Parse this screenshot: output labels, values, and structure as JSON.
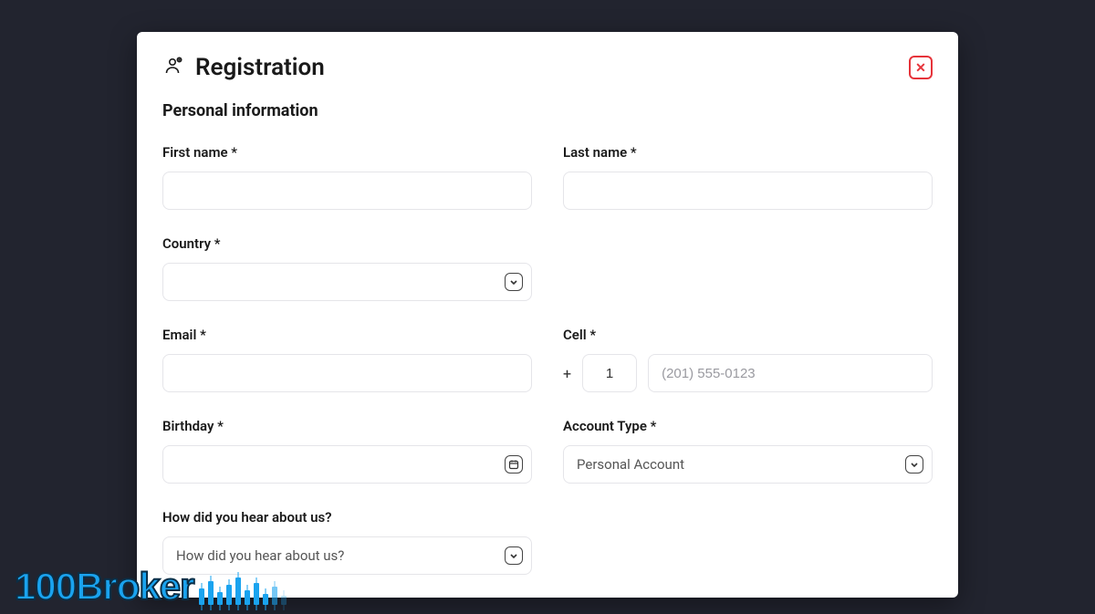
{
  "modal": {
    "title": "Registration",
    "section": "Personal information"
  },
  "fields": {
    "first_name": {
      "label": "First name *",
      "value": ""
    },
    "last_name": {
      "label": "Last name *",
      "value": ""
    },
    "country": {
      "label": "Country *",
      "value": ""
    },
    "email": {
      "label": "Email *",
      "value": ""
    },
    "cell": {
      "label": "Cell *",
      "prefix": "+",
      "cc": "1",
      "placeholder": "(201) 555-0123",
      "value": ""
    },
    "birthday": {
      "label": "Birthday *",
      "value": ""
    },
    "account_type": {
      "label": "Account Type *",
      "value": "Personal Account"
    },
    "hear": {
      "label": "How did you hear about us?",
      "placeholder": "How did you hear about us?"
    }
  },
  "logo": {
    "text": "100Broker"
  }
}
